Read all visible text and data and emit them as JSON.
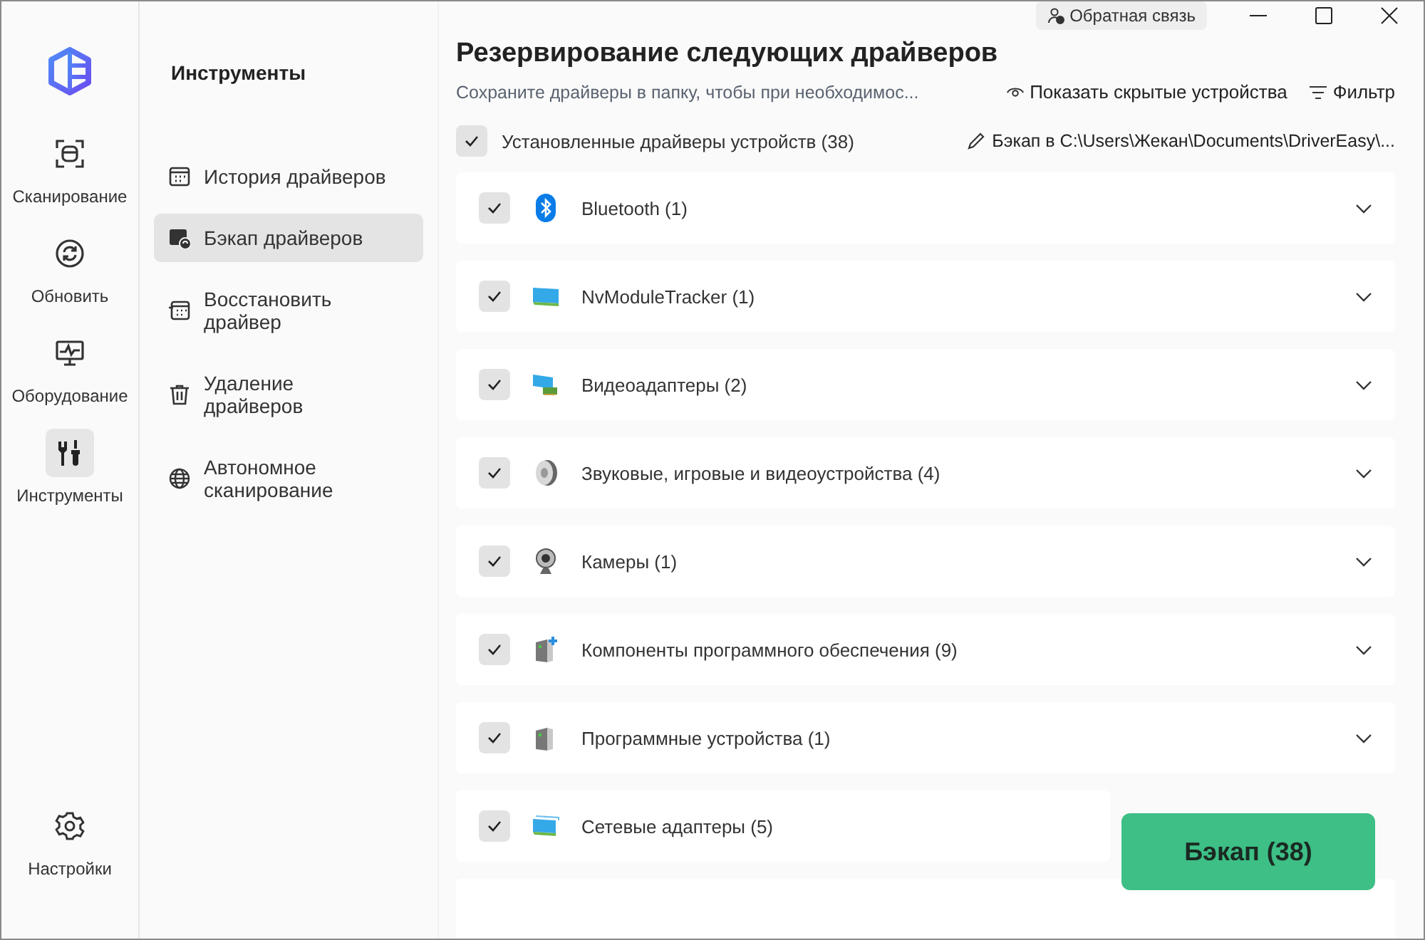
{
  "nav_rail": {
    "items": [
      {
        "label": "Сканирование",
        "selected": false
      },
      {
        "label": "Обновить",
        "selected": false
      },
      {
        "label": "Оборудование",
        "selected": false
      },
      {
        "label": "Инструменты",
        "selected": true
      }
    ],
    "settings": {
      "label": "Настройки"
    }
  },
  "tools_panel": {
    "title": "Инструменты",
    "items": [
      {
        "label": "История драйверов",
        "selected": false
      },
      {
        "label": "Бэкап драйверов",
        "selected": true
      },
      {
        "label": "Восстановить драйвер",
        "selected": false
      },
      {
        "label": "Удаление драйверов",
        "selected": false
      },
      {
        "label": "Автономное сканирование",
        "selected": false
      }
    ]
  },
  "titlebar": {
    "feedback": "Обратная связь"
  },
  "header": {
    "title": "Резервирование следующих драйверов",
    "subtitle": "Сохраните драйверы в папку, чтобы при необходимос...",
    "show_hidden": "Показать скрытые устройства",
    "filter": "Фильтр"
  },
  "select_all": {
    "label": "Установленные драйверы устройств (38)",
    "checked": true
  },
  "backup_path": "Бэкап в C:\\Users\\Жекан\\Documents\\DriverEasy\\...",
  "devices": [
    {
      "name": "Bluetooth (1)",
      "checked": true
    },
    {
      "name": "NvModuleTracker (1)",
      "checked": true
    },
    {
      "name": "Видеоадаптеры (2)",
      "checked": true
    },
    {
      "name": "Звуковые, игровые и видеоустройства (4)",
      "checked": true
    },
    {
      "name": "Камеры (1)",
      "checked": true
    },
    {
      "name": "Компоненты программного обеспечения (9)",
      "checked": true
    },
    {
      "name": "Программные устройства (1)",
      "checked": true
    },
    {
      "name": "Сетевые адаптеры (5)",
      "checked": true
    }
  ],
  "backup_button": "Бэкап (38)"
}
